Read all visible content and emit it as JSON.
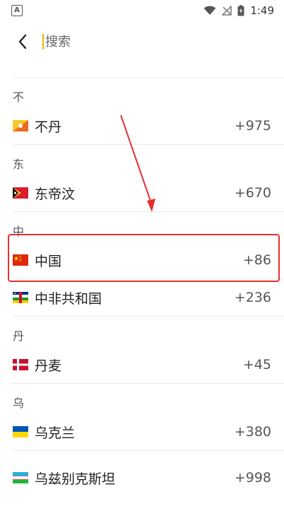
{
  "status_bar": {
    "time": "1:49",
    "left_icon": "A",
    "icons": [
      "wifi-icon",
      "no-signal-icon",
      "battery-charging-icon"
    ]
  },
  "header": {
    "back_icon": "chevron-left-icon",
    "search_placeholder": "搜索"
  },
  "groups": [
    {
      "letter": "不",
      "items": [
        {
          "name": "不丹",
          "code": "+975",
          "flag": "bhutan-flag"
        }
      ]
    },
    {
      "letter": "东",
      "items": [
        {
          "name": "东帝汶",
          "code": "+670",
          "flag": "timor-leste-flag"
        }
      ]
    },
    {
      "letter": "中",
      "items": [
        {
          "name": "中国",
          "code": "+86",
          "flag": "china-flag"
        },
        {
          "name": "中非共和国",
          "code": "+236",
          "flag": "central-african-republic-flag"
        }
      ]
    },
    {
      "letter": "丹",
      "items": [
        {
          "name": "丹麦",
          "code": "+45",
          "flag": "denmark-flag"
        }
      ]
    },
    {
      "letter": "乌",
      "items": [
        {
          "name": "乌克兰",
          "code": "+380",
          "flag": "ukraine-flag"
        },
        {
          "name": "乌兹别克斯坦",
          "code": "+998",
          "flag": "uzbekistan-flag"
        }
      ]
    }
  ],
  "annotation": {
    "highlight_color": "#e53030"
  }
}
